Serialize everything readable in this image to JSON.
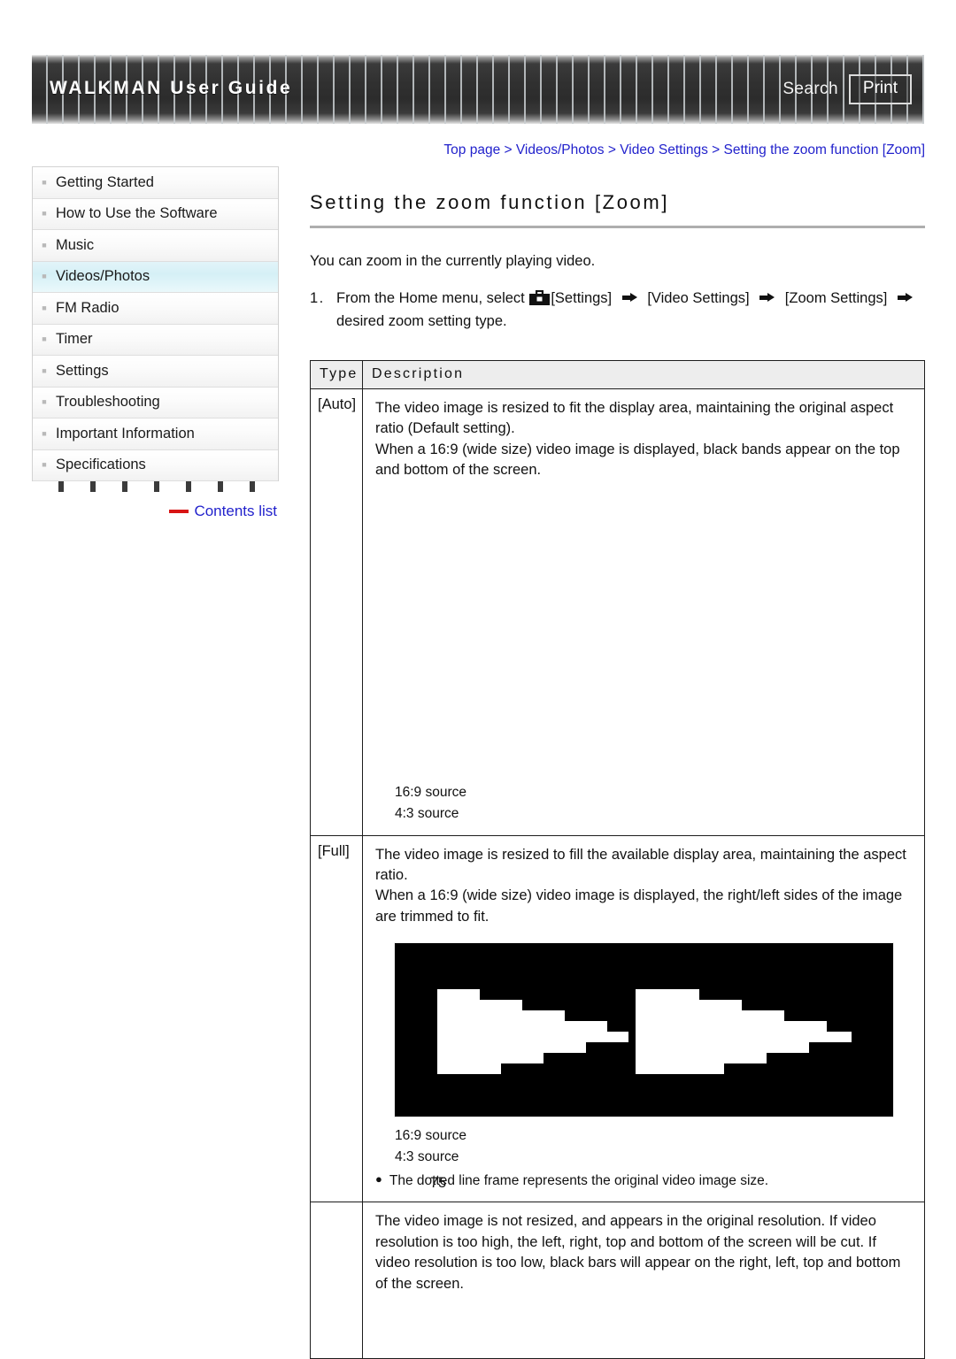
{
  "header": {
    "title": "WALKMAN User Guide",
    "search_label": "Search",
    "print_label": "Print"
  },
  "sidebar": {
    "items": [
      {
        "label": "Getting Started",
        "active": false
      },
      {
        "label": "How to Use the Software",
        "active": false
      },
      {
        "label": "Music",
        "active": false
      },
      {
        "label": "Videos/Photos",
        "active": true
      },
      {
        "label": "FM Radio",
        "active": false
      },
      {
        "label": "Timer",
        "active": false
      },
      {
        "label": "Settings",
        "active": false
      },
      {
        "label": "Troubleshooting",
        "active": false
      },
      {
        "label": "Important Information",
        "active": false
      },
      {
        "label": "Specifications",
        "active": false
      }
    ],
    "contents_link": "Contents list"
  },
  "main": {
    "breadcrumb": "Top page > Videos/Photos > Video Settings > Setting the zoom function [Zoom]",
    "title": "Setting the zoom function [Zoom]",
    "intro": "You can zoom in the currently playing video.",
    "step1": {
      "number": "1.",
      "text_before_icon": "From the Home menu, select",
      "settings_label": "[Settings]",
      "video_settings_label": "[Video Settings]",
      "zoom_settings_label": "[Zoom Settings]",
      "text_after": "desired zoom setting type.",
      "toolbox_icon": "toolbox-icon",
      "arrow_icon": "right-arrow-icon"
    },
    "table": {
      "headers": [
        "Type",
        "Description"
      ],
      "rows": [
        {
          "type": "[Auto]",
          "description_lines": [
            "The video image is resized to fit the display area, maintaining the original aspect ratio (Default setting).",
            "When a 16:9 (wide size) video image is displayed, black bands appear on the top and bottom of the screen."
          ],
          "image_caption_1": "16:9 source",
          "image_caption_2": "4:3 source",
          "note": null
        },
        {
          "type": "[Full]",
          "description_lines": [
            "The video image is resized to fill the available display area, maintaining the aspect ratio.",
            "When a 16:9 (wide size) video image is displayed, the right/left sides of the image are trimmed to fit."
          ],
          "image_caption_1": "16:9 source",
          "image_caption_2": "4:3 source",
          "note": "The dotted line frame represents the original video image size.",
          "note_bullet": "●"
        },
        {
          "type": "",
          "description_lines": [
            "The video image is not resized, and appears in the original resolution. If video resolution is too high, the left, right, top and bottom of the screen will be cut. If video resolution is too low, black bars will appear on the right, left, top and bottom of the screen."
          ],
          "image_caption_1": null,
          "image_caption_2": null,
          "note": null
        }
      ]
    }
  },
  "footer": {
    "page_number": "75"
  },
  "colors": {
    "link": "#2222cc",
    "accent_red": "#d81414",
    "header_dark": "#2c2c2c",
    "sidebar_active": "#d5f0f6",
    "table_header_bg": "#ededed"
  }
}
